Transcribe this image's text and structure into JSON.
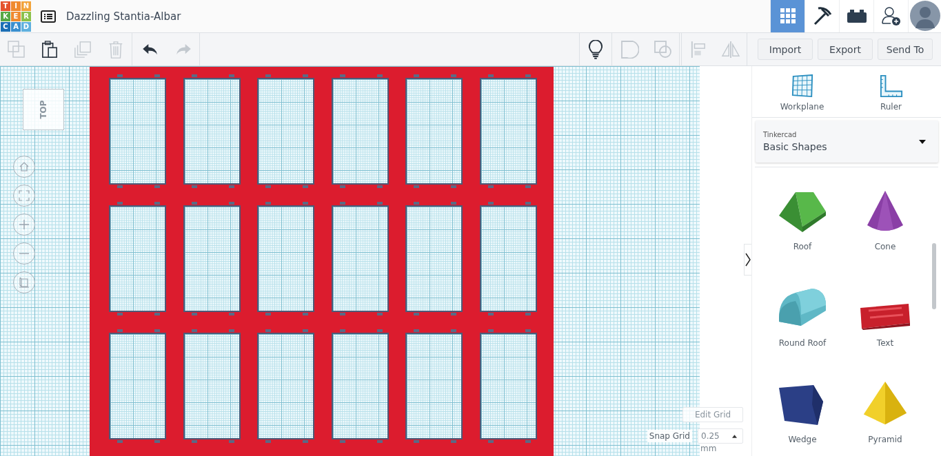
{
  "header": {
    "logo": [
      {
        "letter": "T",
        "color": "#e5532d"
      },
      {
        "letter": "I",
        "color": "#f08a2e"
      },
      {
        "letter": "N",
        "color": "#f2a33a"
      },
      {
        "letter": "K",
        "color": "#57a846"
      },
      {
        "letter": "E",
        "color": "#ef8a2f"
      },
      {
        "letter": "R",
        "color": "#8cc14b"
      },
      {
        "letter": "C",
        "color": "#1c6fb5"
      },
      {
        "letter": "A",
        "color": "#3a8fcf"
      },
      {
        "letter": "D",
        "color": "#5fb0de"
      }
    ],
    "title": "Dazzling Stantia-Albar",
    "nav": [
      {
        "kind": "grid",
        "selected": true
      },
      {
        "kind": "pickaxe",
        "selected": false
      },
      {
        "kind": "brick",
        "selected": false
      },
      {
        "kind": "user-add",
        "selected": false
      },
      {
        "kind": "avatar",
        "selected": false
      }
    ]
  },
  "toolbar": {
    "left": [
      {
        "kind": "copy",
        "disabled": true
      },
      {
        "kind": "paste",
        "disabled": false
      },
      {
        "kind": "duplicate",
        "disabled": true
      },
      {
        "kind": "delete",
        "disabled": true
      },
      {
        "kind": "undo",
        "disabled": false
      },
      {
        "kind": "redo",
        "disabled": true
      }
    ],
    "right": [
      {
        "kind": "bulb",
        "disabled": false
      },
      {
        "kind": "group",
        "disabled": true
      },
      {
        "kind": "ungroup",
        "disabled": true
      },
      {
        "kind": "align",
        "disabled": true
      },
      {
        "kind": "mirror",
        "disabled": true
      }
    ],
    "buttons": [
      "Import",
      "Export",
      "Send To"
    ]
  },
  "view_cube": {
    "label": "TOP"
  },
  "grid_controls": {
    "edit_button": "Edit Grid",
    "snap_label": "Snap Grid",
    "snap_value": "0.25",
    "unit": "mm"
  },
  "panel": {
    "tools": [
      {
        "kind": "workplane",
        "label": "Workplane"
      },
      {
        "kind": "ruler",
        "label": "Ruler"
      }
    ],
    "library": {
      "label": "Tinkercad",
      "value": "Basic Shapes"
    },
    "shapes": [
      {
        "kind": "roof",
        "label": "Roof"
      },
      {
        "kind": "cone",
        "label": "Cone"
      },
      {
        "kind": "round-roof",
        "label": "Round Roof"
      },
      {
        "kind": "text",
        "label": "Text"
      },
      {
        "kind": "wedge",
        "label": "Wedge"
      },
      {
        "kind": "pyramid",
        "label": "Pyramid"
      }
    ]
  }
}
